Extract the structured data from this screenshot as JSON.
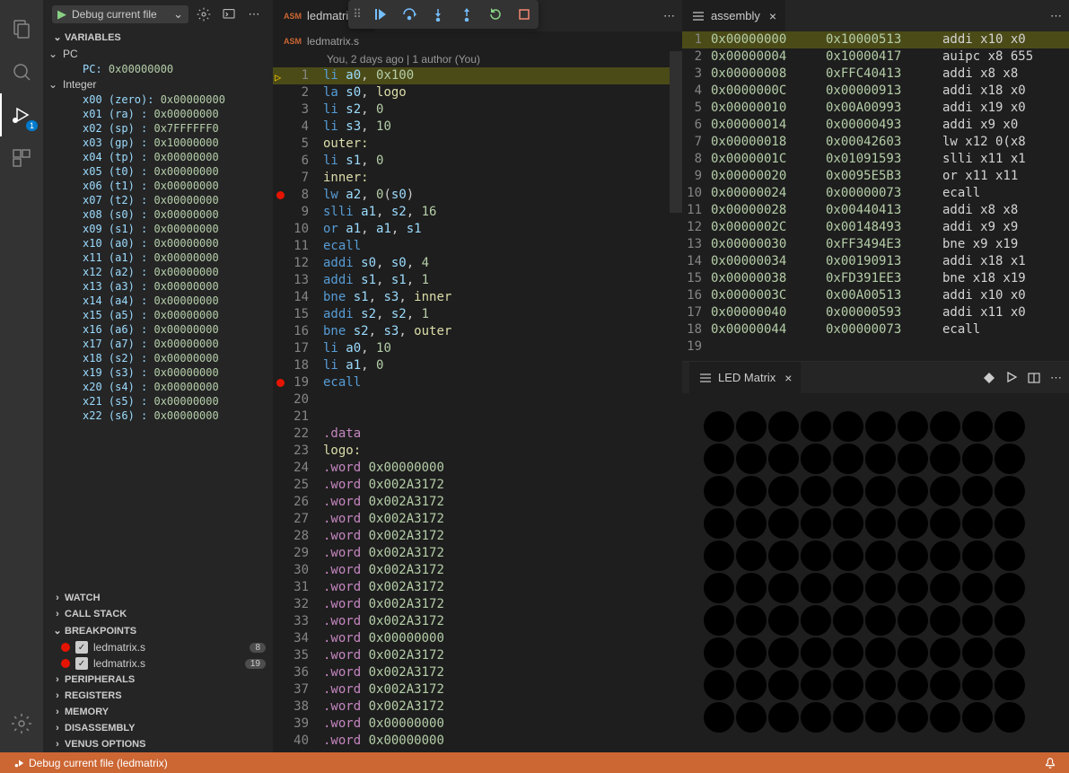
{
  "debugConfig": "Debug current file",
  "sections": {
    "variables": "VARIABLES",
    "watch": "WATCH",
    "callStack": "CALL STACK",
    "breakpoints": "BREAKPOINTS",
    "peripherals": "PERIPHERALS",
    "registers": "REGISTERS",
    "memory": "MEMORY",
    "disassembly": "DISASSEMBLY",
    "venus": "VENUS OPTIONS"
  },
  "varGroups": {
    "pc": "PC",
    "integer": "Integer"
  },
  "pcVar": {
    "name": "PC: ",
    "val": "0x00000000"
  },
  "registers": [
    {
      "name": "x00 (zero): ",
      "val": "0x00000000"
    },
    {
      "name": "x01 (ra)  : ",
      "val": "0x00000000"
    },
    {
      "name": "x02 (sp)  : ",
      "val": "0x7FFFFFF0"
    },
    {
      "name": "x03 (gp)  : ",
      "val": "0x10000000"
    },
    {
      "name": "x04 (tp)  : ",
      "val": "0x00000000"
    },
    {
      "name": "x05 (t0)  : ",
      "val": "0x00000000"
    },
    {
      "name": "x06 (t1)  : ",
      "val": "0x00000000"
    },
    {
      "name": "x07 (t2)  : ",
      "val": "0x00000000"
    },
    {
      "name": "x08 (s0)  : ",
      "val": "0x00000000"
    },
    {
      "name": "x09 (s1)  : ",
      "val": "0x00000000"
    },
    {
      "name": "x10 (a0)  : ",
      "val": "0x00000000"
    },
    {
      "name": "x11 (a1)  : ",
      "val": "0x00000000"
    },
    {
      "name": "x12 (a2)  : ",
      "val": "0x00000000"
    },
    {
      "name": "x13 (a3)  : ",
      "val": "0x00000000"
    },
    {
      "name": "x14 (a4)  : ",
      "val": "0x00000000"
    },
    {
      "name": "x15 (a5)  : ",
      "val": "0x00000000"
    },
    {
      "name": "x16 (a6)  : ",
      "val": "0x00000000"
    },
    {
      "name": "x17 (a7)  : ",
      "val": "0x00000000"
    },
    {
      "name": "x18 (s2)  : ",
      "val": "0x00000000"
    },
    {
      "name": "x19 (s3)  : ",
      "val": "0x00000000"
    },
    {
      "name": "x20 (s4)  : ",
      "val": "0x00000000"
    },
    {
      "name": "x21 (s5)  : ",
      "val": "0x00000000"
    },
    {
      "name": "x22 (s6)  : ",
      "val": "0x00000000"
    }
  ],
  "breakpoints": [
    {
      "file": "ledmatrix.s",
      "line": "8"
    },
    {
      "file": "ledmatrix.s",
      "line": "19"
    }
  ],
  "tabName": "ledmatrix.s",
  "breadcrumbFile": "ledmatrix.s",
  "codelens": "You, 2 days ago | 1 author (You)",
  "code": [
    {
      "n": 1,
      "exec": true,
      "tokens": [
        [
          "inst",
          "li"
        ],
        [
          "txt",
          " "
        ],
        [
          "reg",
          "a0"
        ],
        [
          "txt",
          ", "
        ],
        [
          "num",
          "0x100"
        ]
      ]
    },
    {
      "n": 2,
      "tokens": [
        [
          "inst",
          "la"
        ],
        [
          "txt",
          " "
        ],
        [
          "reg",
          "s0"
        ],
        [
          "txt",
          ", "
        ],
        [
          "label",
          "logo"
        ]
      ]
    },
    {
      "n": 3,
      "tokens": [
        [
          "inst",
          "li"
        ],
        [
          "txt",
          " "
        ],
        [
          "reg",
          "s2"
        ],
        [
          "txt",
          ", "
        ],
        [
          "num",
          "0"
        ]
      ]
    },
    {
      "n": 4,
      "tokens": [
        [
          "inst",
          "li"
        ],
        [
          "txt",
          " "
        ],
        [
          "reg",
          "s3"
        ],
        [
          "txt",
          ", "
        ],
        [
          "num",
          "10"
        ]
      ]
    },
    {
      "n": 5,
      "tokens": [
        [
          "label",
          "outer:"
        ]
      ]
    },
    {
      "n": 6,
      "tokens": [
        [
          "inst",
          "li"
        ],
        [
          "txt",
          " "
        ],
        [
          "reg",
          "s1"
        ],
        [
          "txt",
          ", "
        ],
        [
          "num",
          "0"
        ]
      ]
    },
    {
      "n": 7,
      "tokens": [
        [
          "label",
          "inner:"
        ]
      ]
    },
    {
      "n": 8,
      "bp": true,
      "tokens": [
        [
          "inst",
          "lw"
        ],
        [
          "txt",
          " "
        ],
        [
          "reg",
          "a2"
        ],
        [
          "txt",
          ", "
        ],
        [
          "num",
          "0"
        ],
        [
          "txt",
          "("
        ],
        [
          "reg",
          "s0"
        ],
        [
          "txt",
          ")"
        ]
      ]
    },
    {
      "n": 9,
      "tokens": [
        [
          "inst",
          "slli"
        ],
        [
          "txt",
          " "
        ],
        [
          "reg",
          "a1"
        ],
        [
          "txt",
          ", "
        ],
        [
          "reg",
          "s2"
        ],
        [
          "txt",
          ", "
        ],
        [
          "num",
          "16"
        ]
      ]
    },
    {
      "n": 10,
      "tokens": [
        [
          "inst",
          "or"
        ],
        [
          "txt",
          " "
        ],
        [
          "reg",
          "a1"
        ],
        [
          "txt",
          ", "
        ],
        [
          "reg",
          "a1"
        ],
        [
          "txt",
          ", "
        ],
        [
          "reg",
          "s1"
        ]
      ]
    },
    {
      "n": 11,
      "tokens": [
        [
          "inst",
          "ecall"
        ]
      ]
    },
    {
      "n": 12,
      "tokens": [
        [
          "inst",
          "addi"
        ],
        [
          "txt",
          " "
        ],
        [
          "reg",
          "s0"
        ],
        [
          "txt",
          ", "
        ],
        [
          "reg",
          "s0"
        ],
        [
          "txt",
          ", "
        ],
        [
          "num",
          "4"
        ]
      ]
    },
    {
      "n": 13,
      "tokens": [
        [
          "inst",
          "addi"
        ],
        [
          "txt",
          " "
        ],
        [
          "reg",
          "s1"
        ],
        [
          "txt",
          ", "
        ],
        [
          "reg",
          "s1"
        ],
        [
          "txt",
          ", "
        ],
        [
          "num",
          "1"
        ]
      ]
    },
    {
      "n": 14,
      "tokens": [
        [
          "inst",
          "bne"
        ],
        [
          "txt",
          " "
        ],
        [
          "reg",
          "s1"
        ],
        [
          "txt",
          ", "
        ],
        [
          "reg",
          "s3"
        ],
        [
          "txt",
          ", "
        ],
        [
          "label",
          "inner"
        ]
      ]
    },
    {
      "n": 15,
      "tokens": [
        [
          "inst",
          "addi"
        ],
        [
          "txt",
          " "
        ],
        [
          "reg",
          "s2"
        ],
        [
          "txt",
          ", "
        ],
        [
          "reg",
          "s2"
        ],
        [
          "txt",
          ", "
        ],
        [
          "num",
          "1"
        ]
      ]
    },
    {
      "n": 16,
      "tokens": [
        [
          "inst",
          "bne"
        ],
        [
          "txt",
          " "
        ],
        [
          "reg",
          "s2"
        ],
        [
          "txt",
          ", "
        ],
        [
          "reg",
          "s3"
        ],
        [
          "txt",
          ", "
        ],
        [
          "label",
          "outer"
        ]
      ]
    },
    {
      "n": 17,
      "tokens": [
        [
          "inst",
          "li"
        ],
        [
          "txt",
          " "
        ],
        [
          "reg",
          "a0"
        ],
        [
          "txt",
          ", "
        ],
        [
          "num",
          "10"
        ]
      ]
    },
    {
      "n": 18,
      "tokens": [
        [
          "inst",
          "li"
        ],
        [
          "txt",
          " "
        ],
        [
          "reg",
          "a1"
        ],
        [
          "txt",
          ", "
        ],
        [
          "num",
          "0"
        ]
      ]
    },
    {
      "n": 19,
      "bp": true,
      "tokens": [
        [
          "inst",
          "ecall"
        ]
      ]
    },
    {
      "n": 20,
      "tokens": []
    },
    {
      "n": 21,
      "tokens": []
    },
    {
      "n": 22,
      "tokens": [
        [
          "dir",
          ".data"
        ]
      ]
    },
    {
      "n": 23,
      "tokens": [
        [
          "label",
          "logo:"
        ]
      ]
    },
    {
      "n": 24,
      "tokens": [
        [
          "dir",
          ".word"
        ],
        [
          "txt",
          " "
        ],
        [
          "num",
          "0x00000000"
        ]
      ]
    },
    {
      "n": 25,
      "tokens": [
        [
          "dir",
          ".word"
        ],
        [
          "txt",
          " "
        ],
        [
          "num",
          "0x002A3172"
        ]
      ]
    },
    {
      "n": 26,
      "tokens": [
        [
          "dir",
          ".word"
        ],
        [
          "txt",
          " "
        ],
        [
          "num",
          "0x002A3172"
        ]
      ]
    },
    {
      "n": 27,
      "tokens": [
        [
          "dir",
          ".word"
        ],
        [
          "txt",
          " "
        ],
        [
          "num",
          "0x002A3172"
        ]
      ]
    },
    {
      "n": 28,
      "tokens": [
        [
          "dir",
          ".word"
        ],
        [
          "txt",
          " "
        ],
        [
          "num",
          "0x002A3172"
        ]
      ]
    },
    {
      "n": 29,
      "tokens": [
        [
          "dir",
          ".word"
        ],
        [
          "txt",
          " "
        ],
        [
          "num",
          "0x002A3172"
        ]
      ]
    },
    {
      "n": 30,
      "tokens": [
        [
          "dir",
          ".word"
        ],
        [
          "txt",
          " "
        ],
        [
          "num",
          "0x002A3172"
        ]
      ]
    },
    {
      "n": 31,
      "tokens": [
        [
          "dir",
          ".word"
        ],
        [
          "txt",
          " "
        ],
        [
          "num",
          "0x002A3172"
        ]
      ]
    },
    {
      "n": 32,
      "tokens": [
        [
          "dir",
          ".word"
        ],
        [
          "txt",
          " "
        ],
        [
          "num",
          "0x002A3172"
        ]
      ]
    },
    {
      "n": 33,
      "tokens": [
        [
          "dir",
          ".word"
        ],
        [
          "txt",
          " "
        ],
        [
          "num",
          "0x002A3172"
        ]
      ]
    },
    {
      "n": 34,
      "tokens": [
        [
          "dir",
          ".word"
        ],
        [
          "txt",
          " "
        ],
        [
          "num",
          "0x00000000"
        ]
      ]
    },
    {
      "n": 35,
      "tokens": [
        [
          "dir",
          ".word"
        ],
        [
          "txt",
          " "
        ],
        [
          "num",
          "0x002A3172"
        ]
      ]
    },
    {
      "n": 36,
      "tokens": [
        [
          "dir",
          ".word"
        ],
        [
          "txt",
          " "
        ],
        [
          "num",
          "0x002A3172"
        ]
      ]
    },
    {
      "n": 37,
      "tokens": [
        [
          "dir",
          ".word"
        ],
        [
          "txt",
          " "
        ],
        [
          "num",
          "0x002A3172"
        ]
      ]
    },
    {
      "n": 38,
      "tokens": [
        [
          "dir",
          ".word"
        ],
        [
          "txt",
          " "
        ],
        [
          "num",
          "0x002A3172"
        ]
      ]
    },
    {
      "n": 39,
      "tokens": [
        [
          "dir",
          ".word"
        ],
        [
          "txt",
          " "
        ],
        [
          "num",
          "0x00000000"
        ]
      ]
    },
    {
      "n": 40,
      "tokens": [
        [
          "dir",
          ".word"
        ],
        [
          "txt",
          " "
        ],
        [
          "num",
          "0x00000000"
        ]
      ]
    }
  ],
  "assemblyTab": "assembly",
  "assembly": [
    {
      "n": 1,
      "addr": "0x00000000",
      "hex": "0x10000513",
      "inst": "addi x10 x0",
      "hl": true
    },
    {
      "n": 2,
      "addr": "0x00000004",
      "hex": "0x10000417",
      "inst": "auipc x8 655"
    },
    {
      "n": 3,
      "addr": "0x00000008",
      "hex": "0xFFC40413",
      "inst": "addi x8 x8 "
    },
    {
      "n": 4,
      "addr": "0x0000000C",
      "hex": "0x00000913",
      "inst": "addi x18 x0"
    },
    {
      "n": 5,
      "addr": "0x00000010",
      "hex": "0x00A00993",
      "inst": "addi x19 x0"
    },
    {
      "n": 6,
      "addr": "0x00000014",
      "hex": "0x00000493",
      "inst": "addi x9 x0 "
    },
    {
      "n": 7,
      "addr": "0x00000018",
      "hex": "0x00042603",
      "inst": "lw x12 0(x8"
    },
    {
      "n": 8,
      "addr": "0x0000001C",
      "hex": "0x01091593",
      "inst": "slli x11 x1"
    },
    {
      "n": 9,
      "addr": "0x00000020",
      "hex": "0x0095E5B3",
      "inst": "or x11 x11 "
    },
    {
      "n": 10,
      "addr": "0x00000024",
      "hex": "0x00000073",
      "inst": "ecall"
    },
    {
      "n": 11,
      "addr": "0x00000028",
      "hex": "0x00440413",
      "inst": "addi x8 x8 "
    },
    {
      "n": 12,
      "addr": "0x0000002C",
      "hex": "0x00148493",
      "inst": "addi x9 x9 "
    },
    {
      "n": 13,
      "addr": "0x00000030",
      "hex": "0xFF3494E3",
      "inst": "bne x9 x19 "
    },
    {
      "n": 14,
      "addr": "0x00000034",
      "hex": "0x00190913",
      "inst": "addi x18 x1"
    },
    {
      "n": 15,
      "addr": "0x00000038",
      "hex": "0xFD391EE3",
      "inst": "bne x18 x19"
    },
    {
      "n": 16,
      "addr": "0x0000003C",
      "hex": "0x00A00513",
      "inst": "addi x10 x0"
    },
    {
      "n": 17,
      "addr": "0x00000040",
      "hex": "0x00000593",
      "inst": "addi x11 x0"
    },
    {
      "n": 18,
      "addr": "0x00000044",
      "hex": "0x00000073",
      "inst": "ecall"
    },
    {
      "n": 19,
      "addr": "",
      "hex": "",
      "inst": ""
    }
  ],
  "ledTab": "LED Matrix",
  "statusBar": "Debug current file (ledmatrix)"
}
